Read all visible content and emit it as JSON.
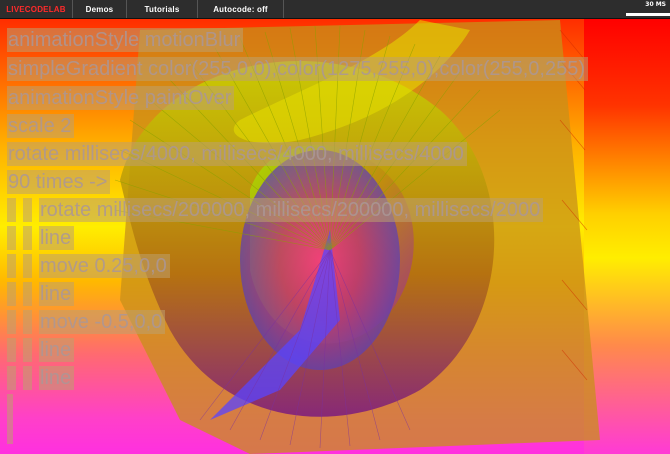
{
  "navbar": {
    "logo": "LIVECODELAB",
    "demos": "Demos",
    "tutorials": "Tutorials",
    "autocode": "Autocode: off"
  },
  "stats": {
    "fps_label": "30 MS"
  },
  "editor": {
    "lines": [
      {
        "indent": 0,
        "text": "animationStyle motionBlur"
      },
      {
        "indent": 0,
        "text": "simpleGradient color(255,0,0),color(1275,255,0),color(255,0,255)"
      },
      {
        "indent": 0,
        "text": "animationStyle paintOver"
      },
      {
        "indent": 0,
        "text": "scale 2"
      },
      {
        "indent": 0,
        "text": "rotate millisecs/4000, millisecs/4000,  millisecs/4000"
      },
      {
        "indent": 0,
        "text": "90 times ->"
      },
      {
        "indent": 1,
        "text": "rotate millisecs/200000, millisecs/200000,  millisecs/2000"
      },
      {
        "indent": 1,
        "text": "line"
      },
      {
        "indent": 1,
        "text": "move 0.25,0,0"
      },
      {
        "indent": 1,
        "text": "line"
      },
      {
        "indent": 1,
        "text": "move -0.5,0,0"
      },
      {
        "indent": 1,
        "text": "line"
      },
      {
        "indent": 1,
        "text": "line"
      }
    ]
  },
  "colors": {
    "navbar_bg": "#2d2d2d",
    "logo": "#ff2a2a",
    "gradient_top": "#ff1a00",
    "gradient_mid": "#ffee00",
    "gradient_bottom": "#ff30e0"
  }
}
